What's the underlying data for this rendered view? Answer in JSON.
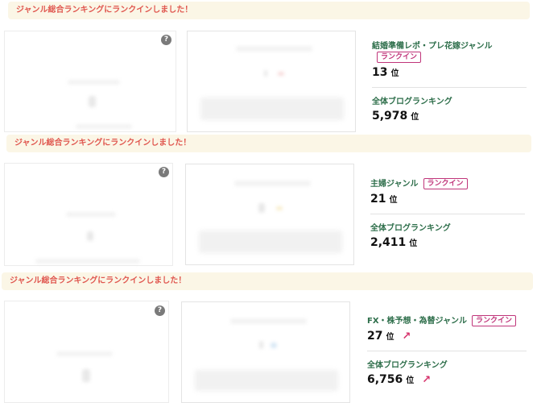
{
  "banner_text": "ジャンル総合ランキングにランクインしました！",
  "help_symbol": "?",
  "entries": [
    {
      "genre": "結婚準備レポ・プレ花嫁ジャンル",
      "badge": "ランクイン",
      "genre_rank": "13",
      "rank_unit": "位",
      "overall_label": "全体ブログランキング",
      "overall_rank": "5,978",
      "trend": ""
    },
    {
      "genre": "主婦ジャンル",
      "badge": "ランクイン",
      "genre_rank": "21",
      "rank_unit": "位",
      "overall_label": "全体ブログランキング",
      "overall_rank": "2,411",
      "trend": ""
    },
    {
      "genre": "FX・株予想・為替ジャンル",
      "badge": "ランクイン",
      "genre_rank": "27",
      "rank_unit": "位",
      "overall_label": "全体ブログランキング",
      "overall_rank": "6,756",
      "trend": "up"
    }
  ],
  "colors": {
    "banner_bg": "#fbf6e6",
    "banner_text": "#e0574f",
    "genre_text": "#2d6e4a",
    "badge": "#c0357a",
    "arrow": "#d6336c"
  }
}
